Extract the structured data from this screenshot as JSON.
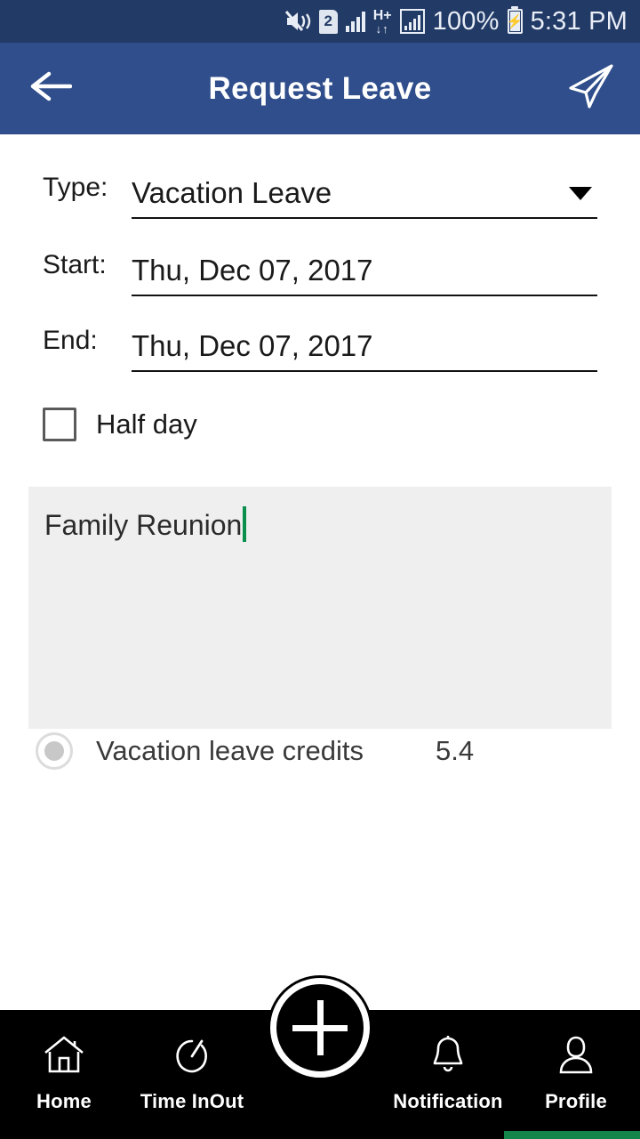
{
  "status_bar": {
    "icons": [
      "mute-vibrate-icon",
      "sim-2-icon",
      "signal-bars-icon",
      "hplus-data-icon",
      "signal-boxed-icon"
    ],
    "sim_label": "2",
    "network_type": "H+",
    "battery_percent": "100%",
    "time": "5:31 PM"
  },
  "app_bar": {
    "back_icon": "arrow-left-icon",
    "title": "Request Leave",
    "send_icon": "send-icon",
    "background": "#2F4E8B"
  },
  "form": {
    "type": {
      "label": "Type:",
      "value": "Vacation Leave",
      "dropdown_icon": "chevron-down-icon"
    },
    "start": {
      "label": "Start:",
      "value": "Thu, Dec 07, 2017"
    },
    "end": {
      "label": "End:",
      "value": "Thu, Dec 07, 2017"
    },
    "half_day": {
      "label": "Half day",
      "checked": false
    },
    "reason": {
      "value": "Family Reunion",
      "placeholder": ""
    },
    "credits": {
      "icon": "radio-filled-icon",
      "label": "Vacation leave credits",
      "value": "5.4"
    }
  },
  "bottom_nav": {
    "items": [
      {
        "icon": "home-icon",
        "label": "Home"
      },
      {
        "icon": "stopwatch-icon",
        "label": "Time InOut"
      },
      {
        "icon": "plus-icon",
        "label": ""
      },
      {
        "icon": "bell-icon",
        "label": "Notification"
      },
      {
        "icon": "person-icon",
        "label": "Profile"
      }
    ],
    "fab_icon": "plus-icon",
    "accent": "#13844A"
  }
}
